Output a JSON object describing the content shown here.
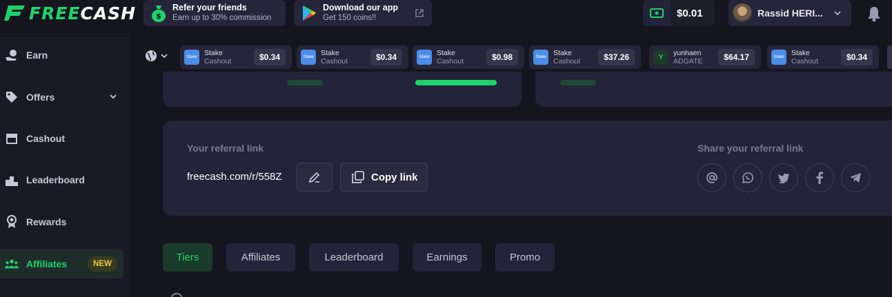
{
  "brand": {
    "logo_free": "FREE",
    "logo_cash": "CASH"
  },
  "promos": [
    {
      "title": "Refer your friends",
      "subtitle": "Earn up to 30% commission"
    },
    {
      "title": "Download our app",
      "subtitle": "Get 150 coins!!"
    }
  ],
  "balance": {
    "amount": "$0.01"
  },
  "user": {
    "name": "Rassid HERI..."
  },
  "sidebar": {
    "items": [
      {
        "label": "Earn"
      },
      {
        "label": "Offers"
      },
      {
        "label": "Cashout"
      },
      {
        "label": "Leaderboard"
      },
      {
        "label": "Rewards"
      },
      {
        "label": "Affiliates",
        "badge": "NEW"
      }
    ]
  },
  "live_feed": [
    {
      "name": "Stake",
      "method": "Cashout",
      "amount": "$0.34"
    },
    {
      "name": "Stake",
      "method": "Cashout",
      "amount": "$0.34"
    },
    {
      "name": "Stake",
      "method": "Cashout",
      "amount": "$0.98"
    },
    {
      "name": "Stake",
      "method": "Cashout",
      "amount": "$37.26"
    },
    {
      "name": "yunhaen",
      "method": "ADGATE",
      "amount": "$64.17"
    },
    {
      "name": "Stake",
      "method": "Cashout",
      "amount": "$0.34"
    }
  ],
  "referral": {
    "title": "Your referral link",
    "link": "freecash.com/r/558Z",
    "copy_label": "Copy link",
    "share_title": "Share your referral link"
  },
  "tabs": [
    {
      "label": "Tiers",
      "active": true
    },
    {
      "label": "Affiliates"
    },
    {
      "label": "Leaderboard"
    },
    {
      "label": "Earnings"
    },
    {
      "label": "Promo"
    }
  ],
  "colors": {
    "accent": "#1fd36a",
    "panel": "#23233a",
    "background": "#15151f",
    "badge": "#e8c83a"
  }
}
